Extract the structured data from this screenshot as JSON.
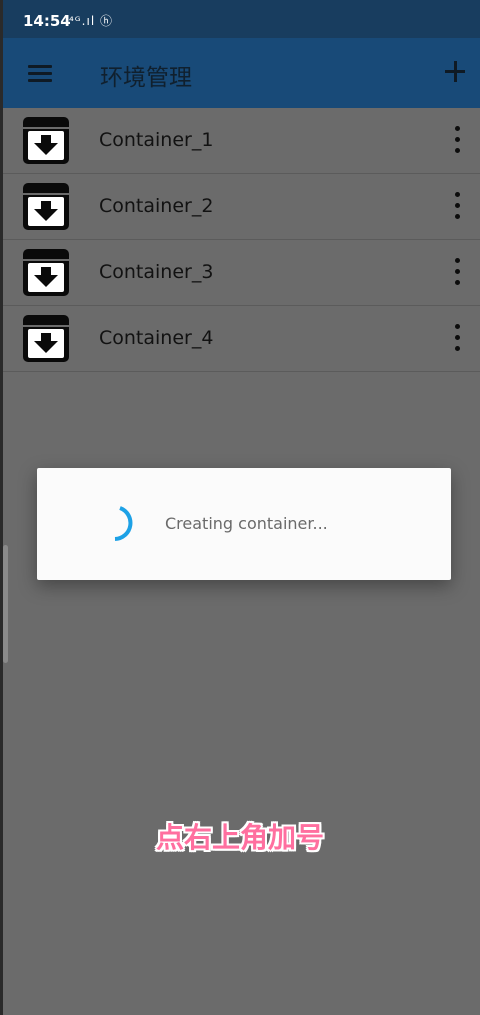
{
  "status_bar": {
    "time": "14:54",
    "indicators": "ᴴᴰ⁴ᴳ.ıl HD"
  },
  "app_bar": {
    "menu_icon": "hamburger-menu-icon",
    "title": "环境管理",
    "add_icon": "plus-icon"
  },
  "containers": [
    {
      "label": "Container_1",
      "icon": "archive-download-icon",
      "more_icon": "vertical-dots-icon"
    },
    {
      "label": "Container_2",
      "icon": "archive-download-icon",
      "more_icon": "vertical-dots-icon"
    },
    {
      "label": "Container_3",
      "icon": "archive-download-icon",
      "more_icon": "vertical-dots-icon"
    },
    {
      "label": "Container_4",
      "icon": "archive-download-icon",
      "more_icon": "vertical-dots-icon"
    }
  ],
  "dialog": {
    "message": "Creating container...",
    "spinner_icon": "progress-spinner-icon"
  },
  "caption": "点右上角加号",
  "colors": {
    "app_bar": "#184a78",
    "status_bar": "#183d5f",
    "scrim": "#6b6b6b",
    "spinner": "#1da1e6",
    "caption": "#ff6f9f"
  }
}
